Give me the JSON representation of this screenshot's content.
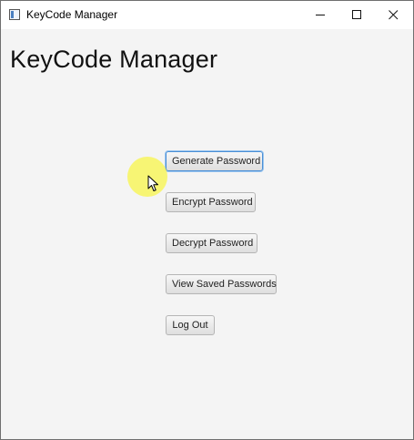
{
  "window": {
    "title": "KeyCode Manager",
    "controls": [
      "minimize-icon",
      "maximize-icon",
      "close-icon"
    ]
  },
  "main": {
    "heading": "KeyCode Manager",
    "buttons": {
      "generate": "Generate Password",
      "encrypt": "Encrypt Password",
      "decrypt": "Decrypt Password",
      "view_saved": "View Saved Passwords",
      "log_out": "Log Out"
    },
    "focused_button": "generate"
  },
  "colors": {
    "content_background": "#f4f4f4",
    "focus_ring": "#4a8fd6",
    "cursor_highlight": "#f7f55d"
  }
}
